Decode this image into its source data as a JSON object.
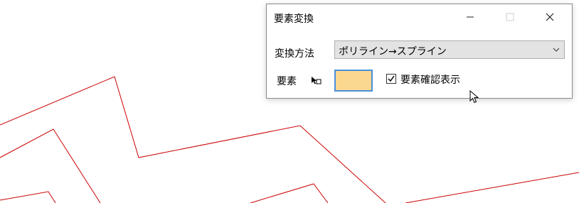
{
  "dialog": {
    "title": "要素変換",
    "method_label": "変換方法",
    "method_value": "ポリライン→スプライン",
    "element_label": "要素",
    "confirm_label": "要素確認表示",
    "confirm_checked": true,
    "element_color": "#fbd890",
    "focus_color": "#4a90d9"
  },
  "window_controls": [
    "minimize-icon",
    "maximize-icon",
    "close-icon"
  ],
  "drawing": {
    "line_color": "#cc0000"
  }
}
